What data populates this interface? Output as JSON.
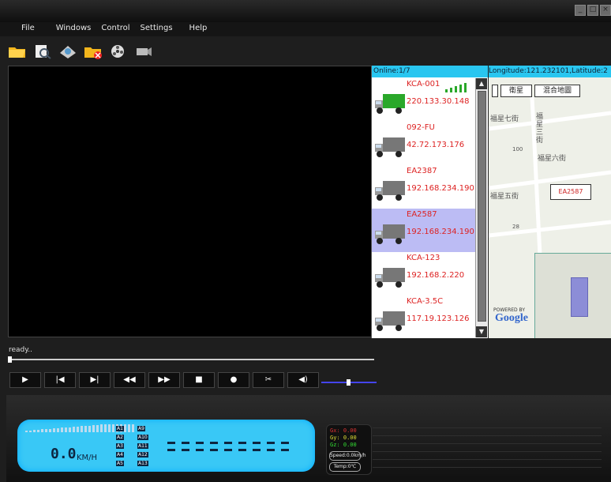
{
  "menu": [
    "File",
    "Windows",
    "Control",
    "Settings",
    "Help"
  ],
  "device_panel": {
    "header": "Online:1/7",
    "devices": [
      {
        "name": "KCA-001",
        "ip": "220.133.30.148",
        "color": "#2aa82a",
        "selected": false
      },
      {
        "name": "092-FU",
        "ip": "42.72.173.176",
        "color": "#777777",
        "selected": false
      },
      {
        "name": "EA2387",
        "ip": "192.168.234.190",
        "color": "#777777",
        "selected": false
      },
      {
        "name": "EA2587",
        "ip": "192.168.234.190",
        "color": "#777777",
        "selected": true
      },
      {
        "name": "KCA-123",
        "ip": "192.168.2.220",
        "color": "#777777",
        "selected": false
      },
      {
        "name": "KCA-3.5C",
        "ip": "117.19.123.126",
        "color": "#777777",
        "selected": false
      }
    ]
  },
  "map": {
    "header": "Longitude:121.232101,Latitude:2",
    "tab_satellite": "衛星",
    "tab_hybrid": "混合地圖",
    "streets": [
      "福星七街",
      "福星六街",
      "福星五街",
      "福星三街"
    ],
    "numbers": [
      "100",
      "28"
    ],
    "marker": "EA2587",
    "powered_by": "POWERED BY",
    "google": "Google"
  },
  "status_text": "ready..",
  "controls": [
    "▶",
    "|◀",
    "▶|",
    "◀◀",
    "▶▶",
    "■",
    "●",
    "✂",
    "◀)"
  ],
  "dash": {
    "speed": "0.0",
    "unit": "KM/H",
    "channels": [
      "A1",
      "A9",
      "A2",
      "A10",
      "A3",
      "A11",
      "A4",
      "A12",
      "A5",
      "A13"
    ],
    "gx": "Gx: 0.00",
    "gy": "Gy: 0.00",
    "gz": "Gz: 0.00",
    "speed_label": "Speed:0.0km/h",
    "temp_label": "Temp:0℃"
  }
}
